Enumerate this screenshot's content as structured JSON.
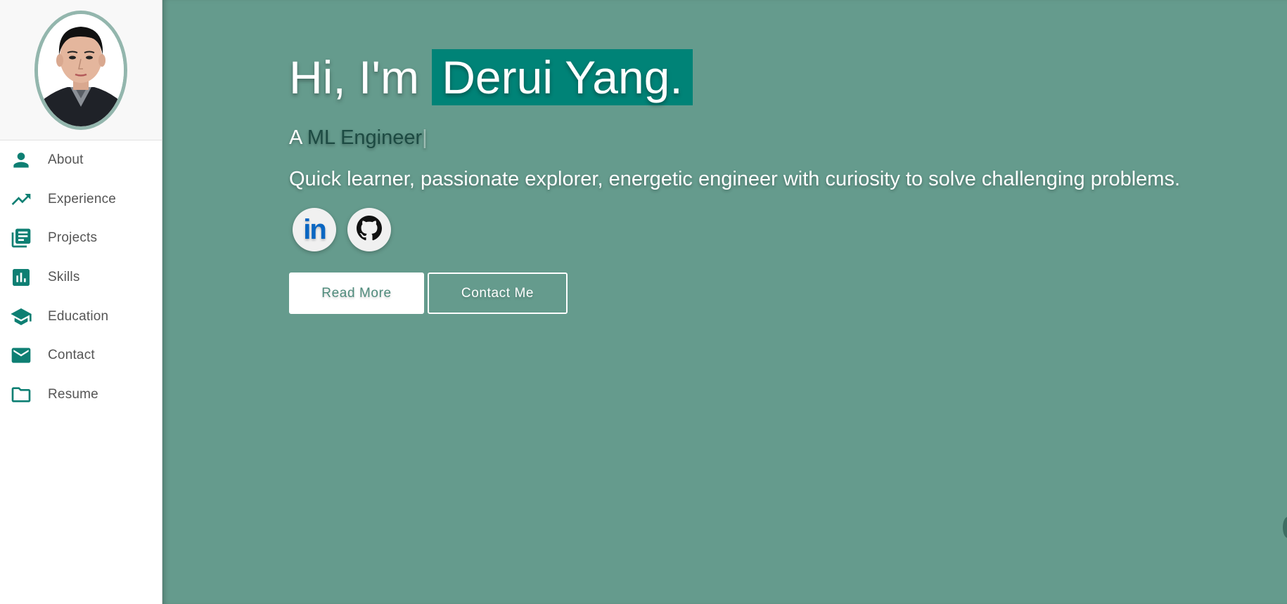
{
  "colors": {
    "accent": "#008377",
    "main_background": "#659b8d",
    "sidebar_background": "#ffffff",
    "avatar_border": "#93b6ad",
    "role_text": "#1c4a42",
    "linkedin_blue": "#0a66c2"
  },
  "sidebar": {
    "items": [
      {
        "label": "About",
        "icon": "person-icon"
      },
      {
        "label": "Experience",
        "icon": "trending-up-icon"
      },
      {
        "label": "Projects",
        "icon": "library-books-icon"
      },
      {
        "label": "Skills",
        "icon": "bar-chart-icon"
      },
      {
        "label": "Education",
        "icon": "graduation-cap-icon"
      },
      {
        "label": "Contact",
        "icon": "mail-icon"
      },
      {
        "label": "Resume",
        "icon": "folder-icon"
      }
    ]
  },
  "hero": {
    "greeting": "Hi, I'm ",
    "name": "Derui Yang.",
    "role_prefix": "A ",
    "role": "ML Engineer",
    "cursor": "|",
    "tagline": "Quick learner, passionate explorer, energetic engineer with curiosity to solve challenging problems.",
    "socials": [
      {
        "icon": "linkedin-icon",
        "text": "in"
      },
      {
        "icon": "github-icon"
      }
    ],
    "buttons": {
      "read_more": "Read More",
      "contact_me": "Contact Me"
    }
  }
}
